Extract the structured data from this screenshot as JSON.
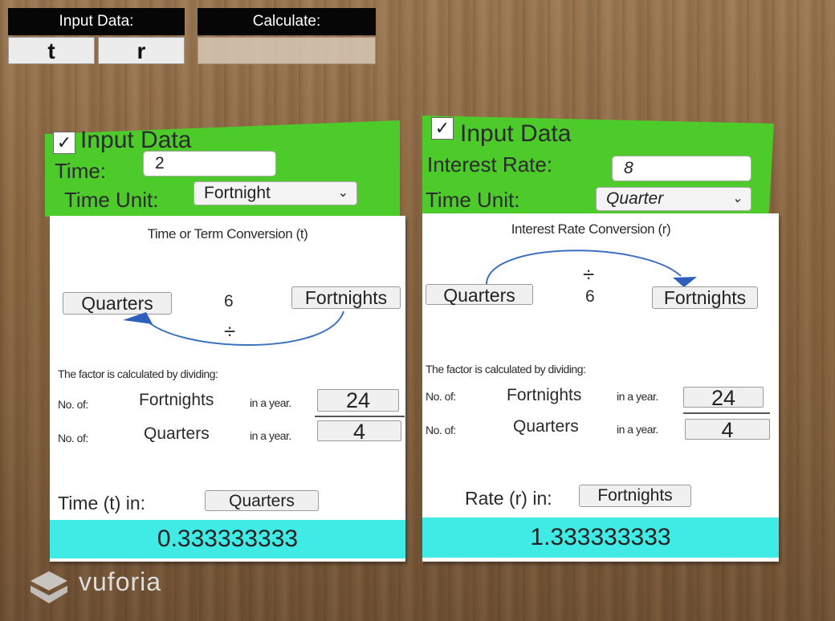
{
  "toolbar": {
    "input_data_label": "Input Data:",
    "calculate_label": "Calculate:",
    "t_button": "t",
    "r_button": "r"
  },
  "left_card": {
    "checkbox_mark": "✓",
    "header": "Input Data",
    "time_label": "Time:",
    "time_value": "2",
    "time_unit_label": "Time Unit:",
    "time_unit_value": "Fortnight",
    "title": "Time or Term Conversion (t)",
    "from_unit": "Quarters",
    "factor": "6",
    "to_unit": "Fortnights",
    "operator": "÷",
    "factor_caption": "The factor is calculated by dividing:",
    "row1_prefix": "No. of:",
    "row1_unit": "Fortnights",
    "row1_suffix": "in a year.",
    "row1_value": "24",
    "row2_prefix": "No. of:",
    "row2_unit": "Quarters",
    "row2_suffix": "in a year.",
    "row2_value": "4",
    "result_label": "Time (t) in:",
    "result_unit": "Quarters",
    "result_value": "0.333333333"
  },
  "right_card": {
    "checkbox_mark": "✓",
    "header": "Input Data",
    "rate_label": "Interest Rate:",
    "rate_value": "8",
    "time_unit_label": "Time Unit:",
    "time_unit_value": "Quarter",
    "title": "Interest Rate Conversion (r)",
    "from_unit": "Quarters",
    "operator": "÷",
    "factor": "6",
    "to_unit": "Fortnights",
    "factor_caption": "The factor is calculated by dividing:",
    "row1_prefix": "No. of:",
    "row1_unit": "Fortnights",
    "row1_suffix": "in a year.",
    "row1_value": "24",
    "row2_prefix": "No. of:",
    "row2_unit": "Quarters",
    "row2_suffix": "in a year.",
    "row2_value": "4",
    "result_label": "Rate (r) in:",
    "result_unit": "Fortnights",
    "result_value": "1.333333333"
  },
  "watermark": "vuforia",
  "colors": {
    "header_green": "#4dcb2a",
    "result_cyan": "#40ebe6",
    "arrow_blue": "#3d6fc0"
  },
  "icons": {
    "checkbox": "check-icon",
    "dropdown": "chevron-down-icon",
    "arrow": "curved-arrow-icon",
    "logo": "vuforia-logo-icon"
  }
}
